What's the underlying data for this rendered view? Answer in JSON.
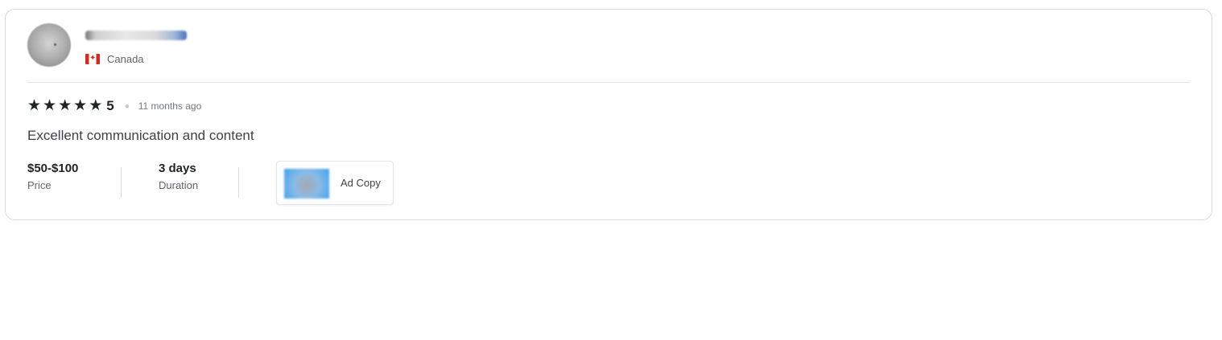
{
  "review": {
    "user": {
      "username": "",
      "country": "Canada",
      "flag_icon": "canada-flag-icon"
    },
    "rating": {
      "stars": 5,
      "score": "5",
      "time_ago": "11 months ago",
      "star_color": "#222325"
    },
    "text": "Excellent communication and content",
    "price": {
      "value": "$50-$100",
      "label": "Price"
    },
    "duration": {
      "value": "3 days",
      "label": "Duration"
    },
    "gig": {
      "title": "Ad Copy"
    }
  }
}
